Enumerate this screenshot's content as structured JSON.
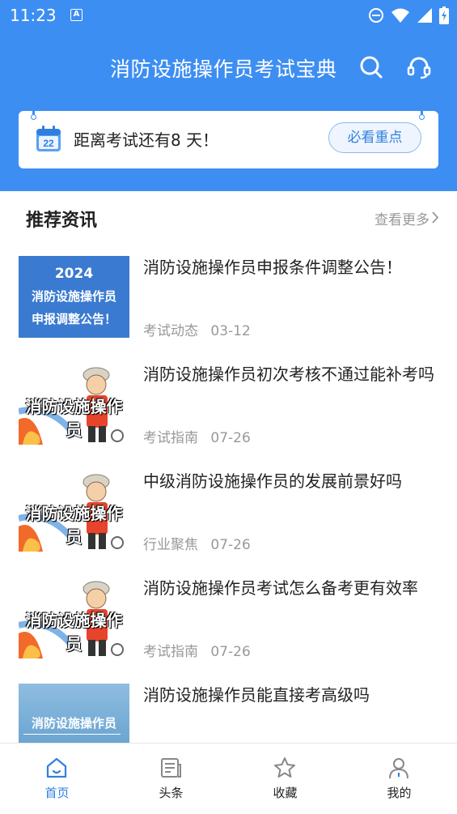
{
  "status_bar": {
    "time": "11:23",
    "app_badge": "A"
  },
  "header": {
    "title": "消防设施操作员考试宝典",
    "search_icon": "search-icon",
    "service_icon": "headset-icon"
  },
  "countdown": {
    "calendar_day": "22",
    "text": "距离考试还有8 天！",
    "button_label": "必看重点"
  },
  "section": {
    "title": "推荐资讯",
    "more_label": "查看更多"
  },
  "articles": [
    {
      "title": "消防设施操作员申报条件调整公告！",
      "category": "考试动态",
      "date": "03-12",
      "thumb_lines": [
        "2024",
        "消防设施操作员",
        "申报调整公告！"
      ]
    },
    {
      "title": "消防设施操作员初次考核不通过能补考吗",
      "category": "考试指南",
      "date": "07-26",
      "thumb_caption": "消防设施操作员"
    },
    {
      "title": "中级消防设施操作员的发展前景好吗",
      "category": "行业聚焦",
      "date": "07-26",
      "thumb_caption": "消防设施操作员"
    },
    {
      "title": "消防设施操作员考试怎么备考更有效率",
      "category": "考试指南",
      "date": "07-26",
      "thumb_caption": "消防设施操作员"
    },
    {
      "title": "消防设施操作员能直接考高级吗",
      "category": "",
      "date": "",
      "thumb_caption": "消防设施操作员"
    }
  ],
  "tabbar": {
    "items": [
      {
        "label": "首页",
        "icon": "home-icon",
        "active": true
      },
      {
        "label": "头条",
        "icon": "news-icon",
        "active": false
      },
      {
        "label": "收藏",
        "icon": "star-icon",
        "active": false
      },
      {
        "label": "我的",
        "icon": "profile-icon",
        "active": false
      }
    ]
  },
  "colors": {
    "brand": "#3d8ef2",
    "active_tab": "#2f7fe0",
    "muted": "#999999"
  }
}
